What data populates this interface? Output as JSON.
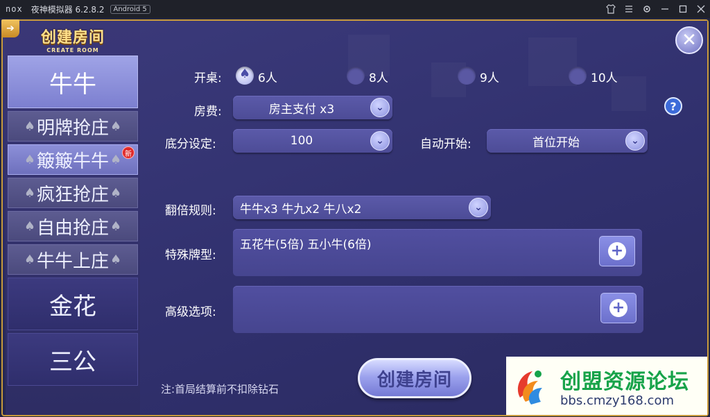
{
  "titlebar": {
    "logo": "nox",
    "app_name": "夜神模拟器 6.2.8.2",
    "android_badge": "Android 5",
    "controls": [
      "shirt-icon",
      "menu-icon",
      "gear-icon",
      "minimize-icon",
      "maximize-icon",
      "close-icon"
    ]
  },
  "header": {
    "title_cn": "创建房间",
    "title_en": "CREATE ROOM",
    "back_icon": "arrow-icon"
  },
  "sidebar": {
    "items": [
      {
        "label": "牛牛",
        "kind": "big",
        "active": true
      },
      {
        "label": "明牌抢庄",
        "kind": "sub",
        "active": false
      },
      {
        "label": "簸簸牛牛",
        "kind": "sub",
        "active": true,
        "badge": "新"
      },
      {
        "label": "疯狂抢庄",
        "kind": "sub",
        "active": false
      },
      {
        "label": "自由抢庄",
        "kind": "sub",
        "active": false
      },
      {
        "label": "牛牛上庄",
        "kind": "sub",
        "active": false
      },
      {
        "label": "金花",
        "kind": "big",
        "active": false
      },
      {
        "label": "三公",
        "kind": "big",
        "active": false
      }
    ]
  },
  "form": {
    "table_label": "开桌:",
    "table_options": [
      "6人",
      "8人",
      "9人",
      "10人"
    ],
    "table_selected": "6人",
    "fee_label": "房费:",
    "fee_value": "房主支付 x3",
    "base_label": "底分设定:",
    "base_value": "100",
    "autostart_label": "自动开始:",
    "autostart_value": "首位开始",
    "multiplier_label": "翻倍规则:",
    "multiplier_value": "牛牛x3  牛九x2  牛八x2",
    "special_label": "特殊牌型:",
    "special_value": "五花牛(5倍)  五小牛(6倍)",
    "advanced_label": "高级选项:",
    "advanced_value": "",
    "help_text": "?",
    "create_button": "创建房间",
    "note": "注:首局结算前不扣除钻石"
  },
  "watermark": {
    "name": "创盟资源论坛",
    "url": "bbs.cmzy168.com"
  },
  "colors": {
    "frame_gold": "#c89a3c",
    "panel_purple": "#3a3979",
    "watermark_green": "#17a34a"
  }
}
